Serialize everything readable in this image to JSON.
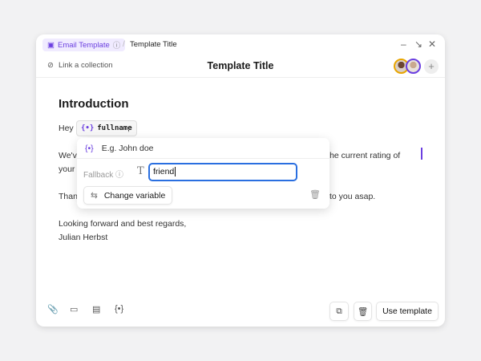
{
  "breadcrumb": {
    "app": "Email Template",
    "current": "Template Title"
  },
  "header": {
    "link_collection": "Link a collection",
    "title": "Template Title"
  },
  "content": {
    "heading": "Introduction",
    "greeting": "Hey",
    "variable": "fullname",
    "comma": ",",
    "line2_left": "We'v",
    "line2_right": "nts. The current rating of",
    "line3_left": "your",
    "line4_left": "Than",
    "line4_right": "to you asap.",
    "closing": "Looking forward and best regards,",
    "signature": "Julian Herbst"
  },
  "popover": {
    "example": "E.g. John doe",
    "fallback_label": "Fallback",
    "fallback_value": "friend",
    "change_variable": "Change variable"
  },
  "footer": {
    "use_template": "Use template"
  }
}
